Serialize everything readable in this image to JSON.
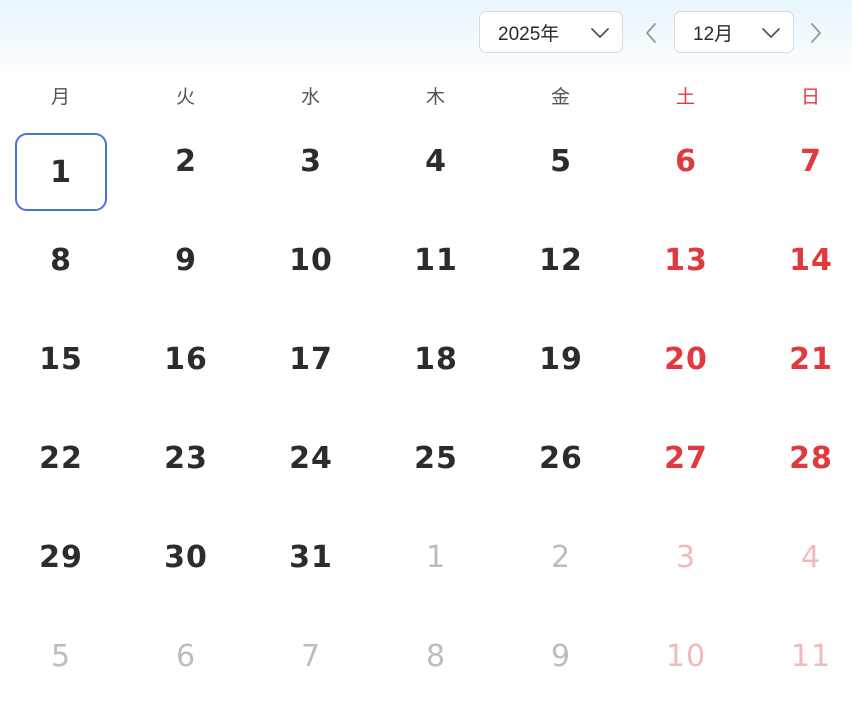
{
  "header": {
    "year_value": "2025年",
    "month_value": "12月"
  },
  "colors": {
    "weekday_text": "#2c2c2c",
    "weekend_text": "#e0393e",
    "outside_month_text": "#bdbdbd",
    "outside_month_weekend_text": "#f2b9bb",
    "selected_border": "#4b72df"
  },
  "icons": {
    "year_dropdown": "chevron-down-icon",
    "month_dropdown": "chevron-down-icon",
    "prev_month": "chevron-left-icon",
    "next_month": "chevron-right-icon"
  },
  "weekdays": [
    "月",
    "火",
    "水",
    "木",
    "金",
    "土",
    "日"
  ],
  "weeks": [
    [
      "1",
      "2",
      "3",
      "4",
      "5",
      "6",
      "7"
    ],
    [
      "8",
      "9",
      "10",
      "11",
      "12",
      "13",
      "14"
    ],
    [
      "15",
      "16",
      "17",
      "18",
      "19",
      "20",
      "21"
    ],
    [
      "22",
      "23",
      "24",
      "25",
      "26",
      "27",
      "28"
    ],
    [
      "29",
      "30",
      "31",
      "1",
      "2",
      "3",
      "4"
    ],
    [
      "5",
      "6",
      "7",
      "8",
      "9",
      "10",
      "11"
    ]
  ],
  "selected_day": "1"
}
